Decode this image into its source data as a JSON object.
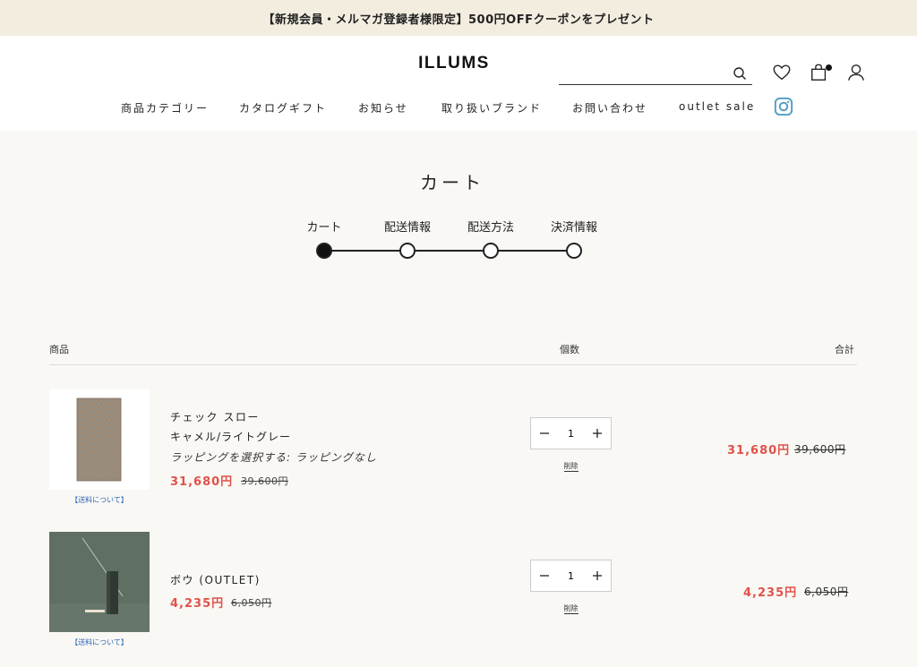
{
  "promo": {
    "text": "【新規会員・メルマガ登録者様限定】500円OFFクーポンをプレゼント"
  },
  "header": {
    "logo": "ILLUMS",
    "search": {
      "value": "",
      "placeholder": ""
    },
    "icons": {
      "search": "search-icon",
      "wishlist": "heart-icon",
      "cart": "shopping-bag-icon",
      "account": "user-icon",
      "social": "instagram-icon"
    }
  },
  "nav": {
    "items": [
      {
        "label": "商品カテゴリー"
      },
      {
        "label": "カタログギフト"
      },
      {
        "label": "お知らせ"
      },
      {
        "label": "取り扱いブランド"
      },
      {
        "label": "お問い合わせ"
      },
      {
        "label": "outlet sale"
      }
    ]
  },
  "page": {
    "title": "カート"
  },
  "steps": {
    "items": [
      {
        "label": "カート",
        "active": true
      },
      {
        "label": "配送情報",
        "active": false
      },
      {
        "label": "配送方法",
        "active": false
      },
      {
        "label": "決済情報",
        "active": false
      }
    ]
  },
  "table": {
    "headers": {
      "product": "商品",
      "quantity": "個数",
      "total": "合計"
    }
  },
  "items": [
    {
      "name": "チェック スロー",
      "variant": "キャメル/ライトグレー",
      "wrapping": "ラッピングを選択する: ラッピングなし",
      "price": "31,680円",
      "original_price": "39,600円",
      "shipping_link": "【送料について】",
      "quantity": "1",
      "delete_label": "削除",
      "total_price": "31,680円",
      "total_original": "39,600円"
    },
    {
      "name": "ボウ (OUTLET)",
      "price": "4,235円",
      "original_price": "6,050円",
      "shipping_link": "【送料について】",
      "quantity": "1",
      "delete_label": "削除",
      "total_price": "4,235円",
      "total_original": "6,050円"
    }
  ],
  "colors": {
    "accent_price": "#e0524a",
    "promo_bg": "#f3ede0",
    "page_bg": "#f9f8f4",
    "link": "#2a62b5",
    "instagram": "#5a9fc4"
  }
}
